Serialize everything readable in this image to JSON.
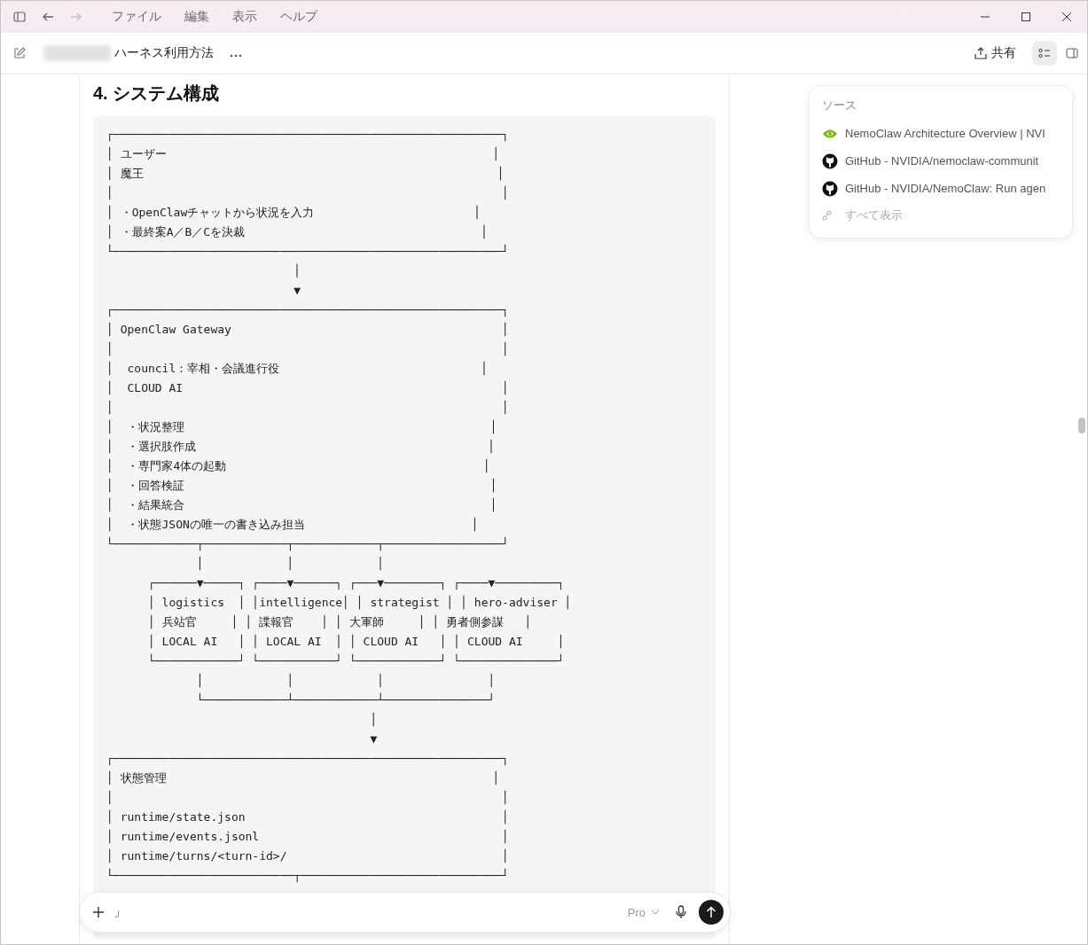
{
  "title_bar": {
    "nav_buttons": [
      {
        "kind": "back",
        "disabled": false
      },
      {
        "kind": "forward",
        "disabled": true
      }
    ],
    "menu": [
      "ファイル",
      "編集",
      "表示",
      "ヘルプ"
    ]
  },
  "header": {
    "title": "ハーネス利用方法",
    "share_label": "共有",
    "sources_toggle": {
      "selected": true
    }
  },
  "document": {
    "heading": "4. システム構成",
    "code_block": {
      "lines": [
        "┌────────────────────────────────────────────────────────┐",
        "│ ユーザー                                               │",
        "│ 魔王                                                   │",
        "│                                                        │",
        "│ ・OpenClawチャットから状況を入力                       │",
        "│ ・最終案A／B／Cを決裁                                  │",
        "└────────────────────────────────────────────────────────┘",
        "                           │",
        "                           ▼",
        "┌────────────────────────────────────────────────────────┐",
        "│ OpenClaw Gateway                                       │",
        "│                                                        │",
        "│  council：宰相・会議進行役                             │",
        "│  CLOUD AI                                              │",
        "│                                                        │",
        "│  ・状況整理                                            │",
        "│  ・選択肢作成                                          │",
        "│  ・専門家4体の起動                                     │",
        "│  ・回答検証                                            │",
        "│  ・結果統合                                            │",
        "│  ・状態JSONの唯一の書き込み担当                        │",
        "└────────────┬────────────┬────────────┬─────────────────┘",
        "             │            │            │",
        "      ┌──────▼─────┐ ┌────▼──────┐ ┌───▼────────┐ ┌────▼─────────┐",
        "      │ logistics  │ │intelligence│ │ strategist │ │ hero-adviser │",
        "      │ 兵站官     │ │ 諜報官    │ │ 大軍師     │ │ 勇者側参謀   │",
        "      │ LOCAL AI   │ │ LOCAL AI  │ │ CLOUD AI   │ │ CLOUD AI     │",
        "      └────────────┘ └───────────┘ └────────────┘ └──────────────┘",
        "             │            │            │               │",
        "             └────────────┴────────────┴───────────────┘",
        "                                      │",
        "                                      ▼",
        "┌────────────────────────────────────────────────────────┐",
        "│ 状態管理                                               │",
        "│                                                        │",
        "│ runtime/state.json                                     │",
        "│ runtime/events.jsonl                                   │",
        "│ runtime/turns/<turn-id>/                               │",
        "└──────────────────────────┬─────────────────────────────┘"
      ]
    }
  },
  "sources": {
    "title": "ソース",
    "items": [
      {
        "kind": "nvidia",
        "title": "NemoClaw Architecture Overview | NVI"
      },
      {
        "kind": "github",
        "title": "GitHub - NVIDIA/nemoclaw-communit"
      },
      {
        "kind": "github",
        "title": "GitHub - NVIDIA/NemoClaw: Run agen"
      }
    ],
    "show_all": "すべて表示"
  },
  "composer": {
    "value": "」",
    "model": "Pro"
  }
}
